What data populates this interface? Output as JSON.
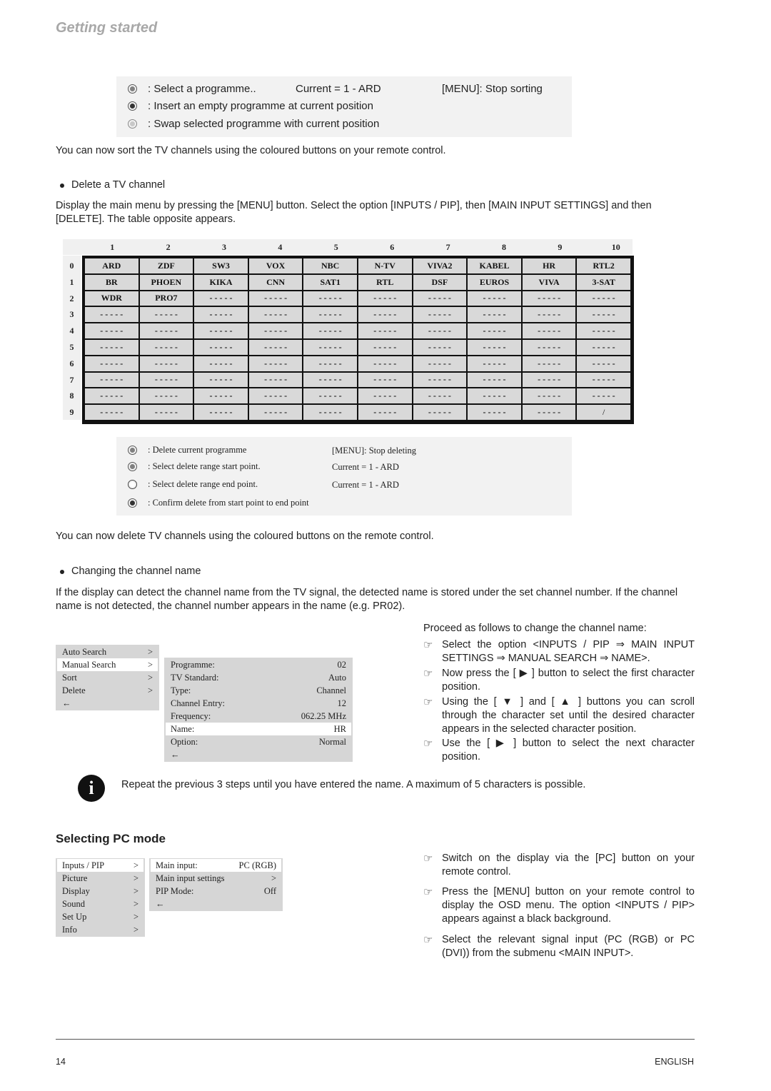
{
  "header": {
    "title": "Getting started"
  },
  "sort_box": {
    "items": [
      {
        "text": ": Select a programme..",
        "color": "#808080"
      },
      {
        "text": ": Insert an empty programme at current position",
        "color": "#333333"
      },
      {
        "text": ": Swap selected programme with current position",
        "color": "#c8c8c8"
      }
    ],
    "current": "Current = 1 - ARD",
    "menu_hint": "[MENU]: Stop sorting"
  },
  "sort_text": "You can now sort the TV channels using the coloured buttons on your remote control.",
  "delete_bullet": "Delete a TV channel",
  "delete_text": "Display the main menu by pressing the [MENU] button. Select the option [INPUTS / PIP], then [MAIN INPUT SETTINGS] and then [DELETE]. The table opposite appears.",
  "channel_table": {
    "columns": [
      "1",
      "2",
      "3",
      "4",
      "5",
      "6",
      "7",
      "8",
      "9",
      "10"
    ],
    "row_labels": [
      "0",
      "1",
      "2",
      "3",
      "4",
      "5",
      "6",
      "7",
      "8",
      "9"
    ],
    "rows": [
      [
        "ARD",
        "ZDF",
        "SW3",
        "VOX",
        "NBC",
        "N-TV",
        "VIVA2",
        "KABEL",
        "HR",
        "RTL2"
      ],
      [
        "BR",
        "PHOEN",
        "KIKA",
        "CNN",
        "SAT1",
        "RTL",
        "DSF",
        "EUROS",
        "VIVA",
        "3-SAT"
      ],
      [
        "WDR",
        "PRO7",
        "- - - - -",
        "- - - - -",
        "- - - - -",
        "- - - - -",
        "- - - - -",
        "- - - - -",
        "- - - - -",
        "- - - - -"
      ],
      [
        "- - - - -",
        "- - - - -",
        "- - - - -",
        "- - - - -",
        "- - - - -",
        "- - - - -",
        "- - - - -",
        "- - - - -",
        "- - - - -",
        "- - - - -"
      ],
      [
        "- - - - -",
        "- - - - -",
        "- - - - -",
        "- - - - -",
        "- - - - -",
        "- - - - -",
        "- - - - -",
        "- - - - -",
        "- - - - -",
        "- - - - -"
      ],
      [
        "- - - - -",
        "- - - - -",
        "- - - - -",
        "- - - - -",
        "- - - - -",
        "- - - - -",
        "- - - - -",
        "- - - - -",
        "- - - - -",
        "- - - - -"
      ],
      [
        "- - - - -",
        "- - - - -",
        "- - - - -",
        "- - - - -",
        "- - - - -",
        "- - - - -",
        "- - - - -",
        "- - - - -",
        "- - - - -",
        "- - - - -"
      ],
      [
        "- - - - -",
        "- - - - -",
        "- - - - -",
        "- - - - -",
        "- - - - -",
        "- - - - -",
        "- - - - -",
        "- - - - -",
        "- - - - -",
        "- - - - -"
      ],
      [
        "- - - - -",
        "- - - - -",
        "- - - - -",
        "- - - - -",
        "- - - - -",
        "- - - - -",
        "- - - - -",
        "- - - - -",
        "- - - - -",
        "- - - - -"
      ],
      [
        "- - - - -",
        "- - - - -",
        "- - - - -",
        "- - - - -",
        "- - - - -",
        "- - - - -",
        "- - - - -",
        "- - - - -",
        "- - - - -",
        "/"
      ]
    ]
  },
  "delete_box": {
    "items": [
      {
        "text": ": Delete current programme",
        "right": "[MENU]: Stop deleting",
        "color": "#808080"
      },
      {
        "text": ": Select delete range start point.",
        "right": "Current = 1 - ARD",
        "color": "#808080"
      },
      {
        "text": ": Select delete range end point.",
        "right": "Current = 1 - ARD",
        "color": "#ffffff"
      },
      {
        "text": ": Confirm delete from start point to end point",
        "right": "",
        "color": "#333333"
      }
    ]
  },
  "delete_after_text": "You can now delete TV channels using the coloured buttons on the remote control.",
  "rename_bullet": "Changing the channel name",
  "rename_text": "If the display can detect the channel name from the TV signal, the detected name is stored under the set channel number. If the channel name is not detected, the channel number appears in the name (e.g. PR02).",
  "search_menu": {
    "items": [
      {
        "label": "Auto Search",
        "arrow": ">"
      },
      {
        "label": "Manual Search",
        "arrow": ">"
      },
      {
        "label": "Sort",
        "arrow": ">"
      },
      {
        "label": "Delete",
        "arrow": ">"
      },
      {
        "label": "←",
        "arrow": ""
      }
    ],
    "selected": "Manual Search"
  },
  "manual_menu": {
    "items": [
      {
        "label": "Programme:",
        "value": "02"
      },
      {
        "label": "TV Standard:",
        "value": "Auto"
      },
      {
        "label": "Type:",
        "value": "Channel"
      },
      {
        "label": "Channel Entry:",
        "value": "12"
      },
      {
        "label": "Frequency:",
        "value": "062.25 MHz"
      },
      {
        "label": "Name:",
        "value": "HR"
      },
      {
        "label": "Option:",
        "value": "Normal"
      },
      {
        "label": "←",
        "value": ""
      }
    ],
    "selected": "Name:"
  },
  "rename_steps": {
    "intro": "Proceed as follows to change the channel name:",
    "items": [
      "Select the option <INPUTS / PIP ⇒ MAIN INPUT SETTINGS ⇒ MANUAL SEARCH ⇒ NAME>.",
      "Now press the [ ▶ ] button to select the first character position.",
      "Using the [ ▼ ] and [ ▲ ] buttons you can scroll through the character set until the desired character appears in the selected character position.",
      "Use the [ ▶ ] button to select the next character position."
    ]
  },
  "info_note": "Repeat the previous 3 steps until you have entered the name. A maximum of 5 characters is possible.",
  "pc_section": {
    "heading": "Selecting PC mode",
    "main_menu": [
      {
        "label": "Inputs / PIP",
        "arrow": ">"
      },
      {
        "label": "Picture",
        "arrow": ">"
      },
      {
        "label": "Display",
        "arrow": ">"
      },
      {
        "label": "Sound",
        "arrow": ">"
      },
      {
        "label": "Set Up",
        "arrow": ">"
      },
      {
        "label": "Info",
        "arrow": ">"
      }
    ],
    "sub_menu": [
      {
        "label": "Main input:",
        "value": "PC (RGB)"
      },
      {
        "label": "Main input settings",
        "value": ">"
      },
      {
        "label": "PIP Mode:",
        "value": "Off"
      },
      {
        "label": "←",
        "value": ""
      }
    ],
    "steps": [
      "Switch on the display via the [PC] button on your remote control.",
      "Press the [MENU] button on your remote control to display the OSD menu. The option <INPUTS / PIP> appears against a black background.",
      "Select the relevant signal input (PC (RGB) or PC (DVI)) from the submenu <MAIN INPUT>."
    ]
  },
  "footer": {
    "page_number": "14",
    "language": "ENGLISH"
  }
}
